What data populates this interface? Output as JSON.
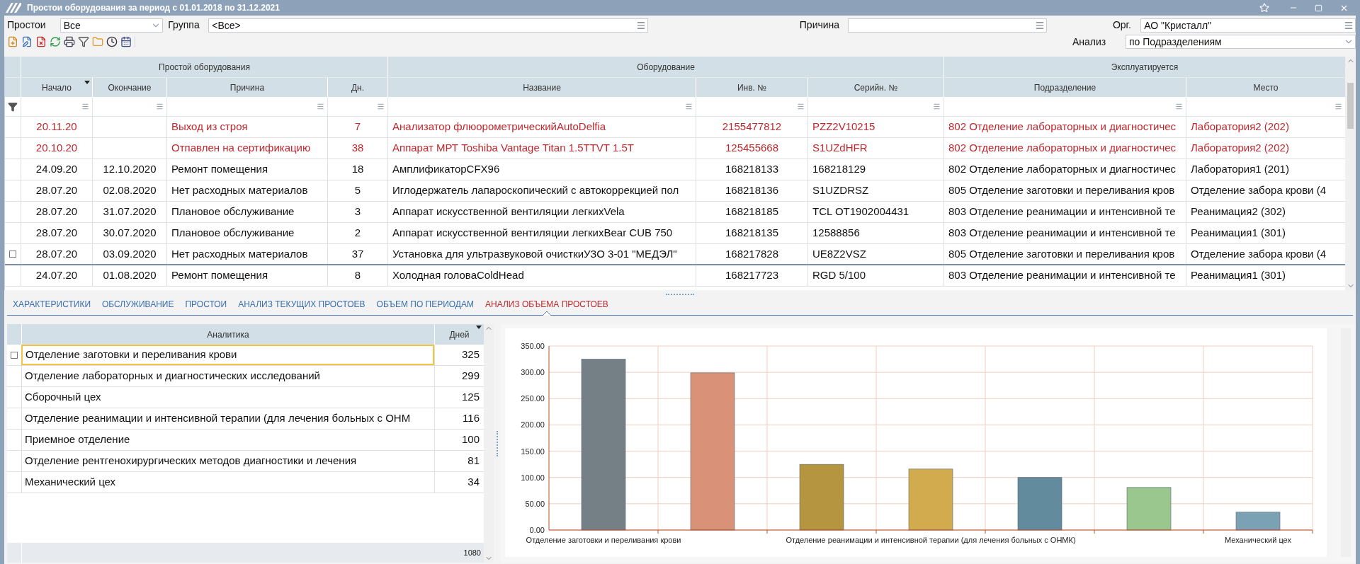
{
  "window": {
    "title": "Простои оборудования за период с 01.01.2018 по 31.12.2021"
  },
  "filters": {
    "downtime": {
      "label": "Простои",
      "value": "Все"
    },
    "group": {
      "label": "Группа",
      "value": "<Все>"
    },
    "reason": {
      "label": "Причина"
    },
    "org": {
      "label": "Орг.",
      "value": "АО \"Кристалл\""
    },
    "analysis": {
      "label": "Анализ",
      "value": "по Подразделениям"
    }
  },
  "table": {
    "groups": [
      {
        "label": "Простой оборудования"
      },
      {
        "label": "Оборудование"
      },
      {
        "label": "Эксплуатируется"
      }
    ],
    "columns": [
      {
        "label": "Начало",
        "sorted": true
      },
      {
        "label": "Окончание",
        "sorted": false
      },
      {
        "label": "Причина",
        "sorted": false
      },
      {
        "label": "Дн.",
        "sorted": false
      },
      {
        "label": "Название",
        "sorted": false
      },
      {
        "label": "Инв. №",
        "sorted": false
      },
      {
        "label": "Серийн. №",
        "sorted": false
      },
      {
        "label": "Подразделение",
        "sorted": false
      },
      {
        "label": "Место",
        "sorted": false
      }
    ],
    "rows": [
      {
        "alert": true,
        "focused": false,
        "cells": [
          "20.11.20",
          "",
          "Выход из строя",
          "7",
          "Анализатор флюорометрическийAutoDelfia",
          "2155477812",
          "PZZ2V10215",
          "802 Отделение лабораторных и диагностичес",
          "Лаборатория2 (202)"
        ]
      },
      {
        "alert": true,
        "focused": false,
        "cells": [
          "20.10.20",
          "",
          "Отпавлен на сертификацию",
          "38",
          "Аппарат МРТ Toshiba Vantage Titan 1.5TTVT 1.5T",
          "125455668",
          "S1UZdHFR",
          "802 Отделение лабораторных и диагностичес",
          "Лаборатория2 (202)"
        ]
      },
      {
        "alert": false,
        "focused": false,
        "cells": [
          "24.09.20",
          "12.10.2020",
          "Ремонт помещения",
          "18",
          "АмплификаторCFX96",
          "168218133",
          "168218129",
          "802 Отделение лабораторных и диагностичес",
          "Лаборатория1 (201)"
        ]
      },
      {
        "alert": false,
        "focused": false,
        "cells": [
          "28.07.20",
          "02.08.2020",
          "Нет расходных материалов",
          "5",
          "Иглодержатель лапароскопический с автокоррекцией пол",
          "168218136",
          "S1UZDRSZ",
          "805 Отделение заготовки и переливания кров",
          "Отделение забора крови (4"
        ]
      },
      {
        "alert": false,
        "focused": false,
        "cells": [
          "28.07.20",
          "31.07.2020",
          "Плановое обслуживание",
          "3",
          "Аппарат искусственной вентиляции легкихVela",
          "168218185",
          "TCL OT1902004431",
          "803 Отделение  реанимации и интенсивной те",
          "Реанимация2 (302)"
        ]
      },
      {
        "alert": false,
        "focused": false,
        "cells": [
          "28.07.20",
          "30.07.2020",
          "Плановое обслуживание",
          "2",
          "Аппарат искусственной вентиляции легкихBear CUB 750",
          "168218135",
          "12588856",
          "803 Отделение  реанимации и интенсивной те",
          "Реанимация1 (301)"
        ]
      },
      {
        "alert": false,
        "focused": true,
        "cells": [
          "28.07.20",
          "03.09.2020",
          "Нет расходных материалов",
          "37",
          "Установка для ультразвуковой очисткиУЗО 3-01 \"МЕДЭЛ\"",
          "168217828",
          "UE8Z2VSZ",
          "805 Отделение заготовки и переливания кров",
          "Отделение забора крови (4"
        ]
      },
      {
        "alert": false,
        "focused": false,
        "cells": [
          "24.07.20",
          "01.08.2020",
          "Ремонт помещения",
          "8",
          "Холодная головаColdHead",
          "168217723",
          "RGD 5/100",
          "803 Отделение  реанимации и интенсивной те",
          "Реанимация1 (301)"
        ]
      }
    ]
  },
  "tabs": [
    {
      "label": "ХАРАКТЕРИСТИКИ",
      "selected": false
    },
    {
      "label": "ОБСЛУЖИВАНИЕ",
      "selected": false
    },
    {
      "label": "ПРОСТОИ",
      "selected": false
    },
    {
      "label": "АНАЛИЗ ТЕКУЩИХ ПРОСТОЕВ",
      "selected": false
    },
    {
      "label": "ОБЪЕМ ПО ПЕРИОДАМ",
      "selected": false
    },
    {
      "label": "АНАЛИЗ ОБЪЕМА ПРОСТОЕВ",
      "selected": true
    }
  ],
  "analytics": {
    "columns": [
      "Аналитика",
      "Дней"
    ],
    "rows": [
      {
        "name": "Отделение заготовки и переливания крови",
        "days": "325",
        "focused": true
      },
      {
        "name": "Отделение лабораторных и диагностических исследований",
        "days": "299",
        "focused": false
      },
      {
        "name": "Сборочный цех",
        "days": "125",
        "focused": false
      },
      {
        "name": "Отделение  реанимации и интенсивной терапии (для лечения больных с ОНМ",
        "days": "116",
        "focused": false
      },
      {
        "name": "Приемное отделение",
        "days": "100",
        "focused": false
      },
      {
        "name": "Отделение рентгенохирургических методов диагностики и лечения",
        "days": "81",
        "focused": false
      },
      {
        "name": "Механический цех",
        "days": "34",
        "focused": false
      }
    ],
    "total": "1080"
  },
  "chart_data": {
    "type": "bar",
    "grid": true,
    "categories": [
      "Отделение заготовки и переливания крови",
      null,
      null,
      "Отделение  реанимации и интенсивной терапии (для лечения больных с ОНМК)",
      null,
      null,
      "Механический цех"
    ],
    "values": [
      325,
      299,
      125,
      116,
      100,
      81,
      34
    ],
    "colors": [
      "#757f86",
      "#d99178",
      "#b5953f",
      "#d2ab4e",
      "#628b9d",
      "#9ac78e",
      "#7ba2b4"
    ],
    "ylim": [
      0,
      350
    ],
    "yticks": [
      {
        "value": 0,
        "label": "0.00"
      },
      {
        "value": 50,
        "label": "50.00"
      },
      {
        "value": 100,
        "label": "100.00"
      },
      {
        "value": 150,
        "label": "150.00"
      },
      {
        "value": 200,
        "label": "200.00"
      },
      {
        "value": 250,
        "label": "250.00"
      },
      {
        "value": 300,
        "label": "300.00"
      },
      {
        "value": 350,
        "label": "350.00"
      }
    ]
  }
}
